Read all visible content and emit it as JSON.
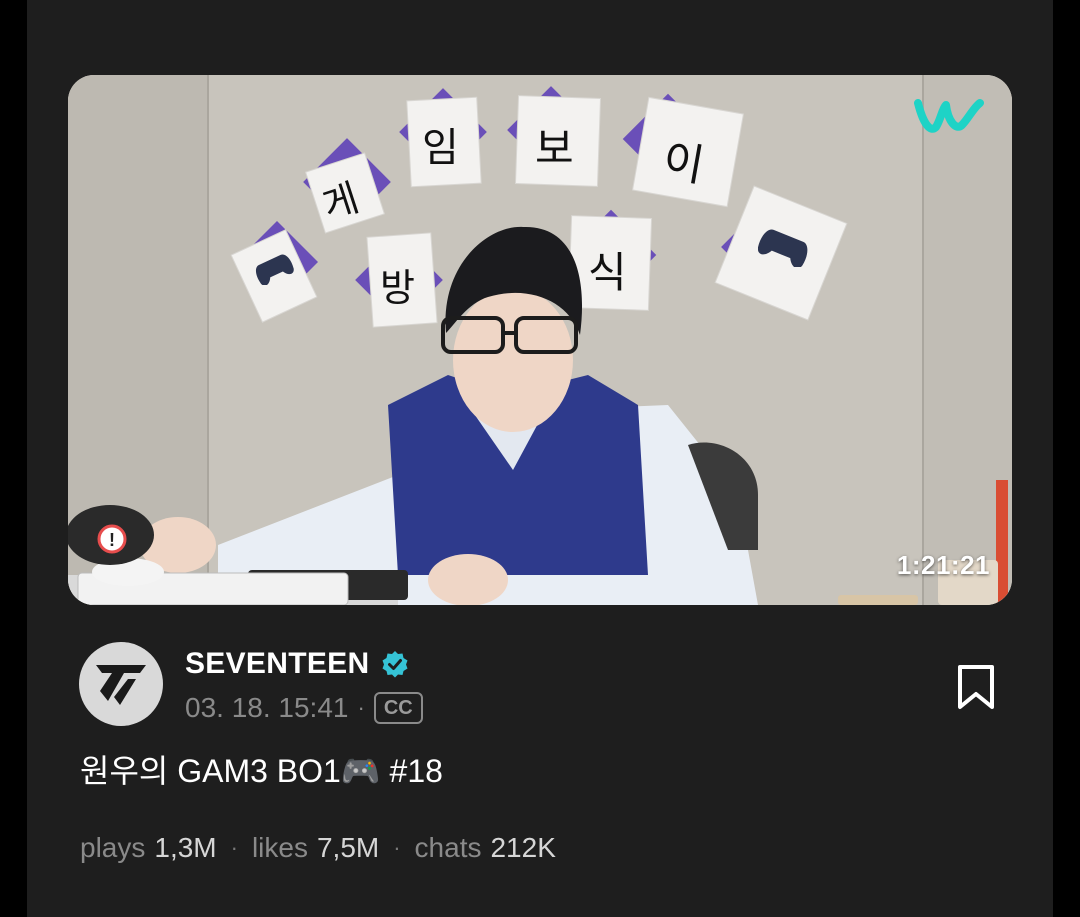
{
  "video": {
    "duration": "1:21:21",
    "thumbnail_signs": [
      "게",
      "임",
      "보",
      "이",
      "방",
      "식"
    ],
    "watermark_icon": "weverse-logo"
  },
  "channel": {
    "name": "SEVENTEEN",
    "verified_icon": "verified-badge-icon",
    "avatar_icon": "seventeen-logo"
  },
  "meta": {
    "date": "03. 18. 15:41",
    "separator": "·",
    "cc_label": "CC"
  },
  "title": "원우의 GAM3 BO1🎮 #18",
  "stats": {
    "plays_label": "plays",
    "plays_value": "1,3M",
    "likes_label": "likes",
    "likes_value": "7,5M",
    "chats_label": "chats",
    "chats_value": "212K",
    "separator": "·"
  },
  "colors": {
    "background": "#1e1e1e",
    "accent_verified": "#35c3d6",
    "weverse": "#1ed3c6",
    "text_secondary": "#8a8a8a"
  }
}
